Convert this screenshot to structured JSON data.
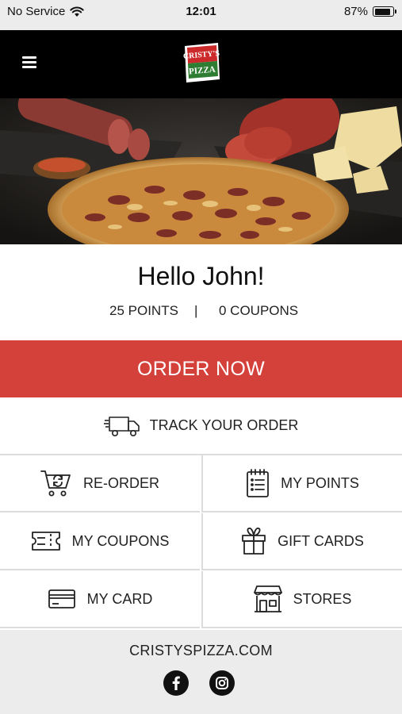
{
  "status_bar": {
    "carrier": "No Service",
    "time": "12:01",
    "battery": "87%",
    "battery_level": 0.87
  },
  "header": {
    "menu_icon": "hamburger-menu-icon",
    "logo_text": "CRISTY'S PIZZA"
  },
  "hero": {
    "image": "pizza-hero-photo"
  },
  "greeting": "Hello John!",
  "stats": {
    "points": "25 POINTS",
    "separator": "|",
    "coupons": "0 COUPONS"
  },
  "order_now": "ORDER NOW",
  "track": {
    "label": "TRACK YOUR ORDER",
    "icon": "delivery-truck-icon"
  },
  "tiles": [
    {
      "label": "RE-ORDER",
      "icon": "reorder-cart-icon"
    },
    {
      "label": "MY POINTS",
      "icon": "points-notepad-icon"
    },
    {
      "label": "MY COUPONS",
      "icon": "coupon-ticket-icon"
    },
    {
      "label": "GIFT CARDS",
      "icon": "gift-icon"
    },
    {
      "label": "MY CARD",
      "icon": "credit-card-icon"
    },
    {
      "label": "STORES",
      "icon": "storefront-icon"
    }
  ],
  "footer": {
    "site": "CRISTYSPIZZA.COM",
    "social": [
      "facebook-icon",
      "instagram-icon"
    ]
  },
  "colors": {
    "accent_red": "#d4403a",
    "header_black": "#000000",
    "footer_gray": "#ececec"
  }
}
